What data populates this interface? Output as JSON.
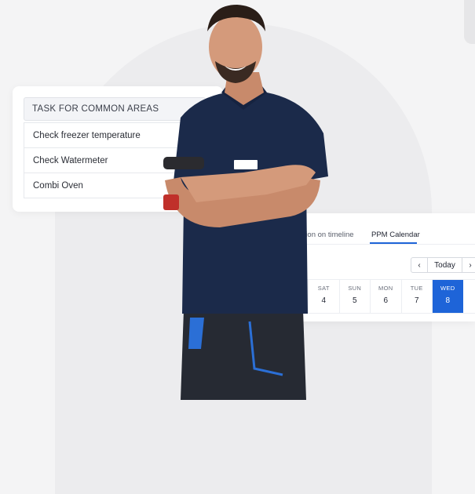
{
  "task_card": {
    "header": "TASK FOR COMMON AREAS",
    "items": [
      "Check freezer temperature",
      "Check Watermeter",
      "Combi Oven"
    ]
  },
  "calendar": {
    "tabs": [
      "pletion on timeline",
      "PPM Calendar"
    ],
    "active_tab": "PPM Calendar",
    "nav": {
      "prev": "‹",
      "today": "Today",
      "next": "›"
    },
    "days": [
      {
        "name": "SAT",
        "date": "4"
      },
      {
        "name": "SUN",
        "date": "5"
      },
      {
        "name": "MON",
        "date": "6"
      },
      {
        "name": "TUE",
        "date": "7"
      },
      {
        "name": "WED",
        "date": "8"
      }
    ],
    "selected_day": "WED"
  },
  "colors": {
    "accent": "#1e64d8",
    "shirt": "#1b2a4a",
    "background": "#f4f4f5"
  },
  "icons": {
    "collapse": "chevron-up-icon"
  }
}
